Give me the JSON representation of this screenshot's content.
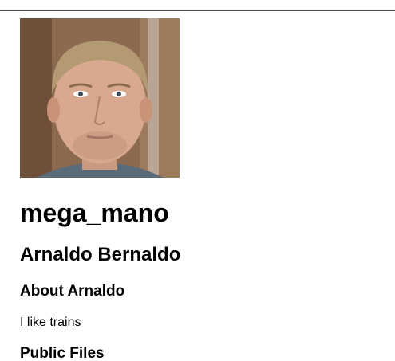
{
  "profile": {
    "username": "mega_mano",
    "full_name": "Arnaldo Bernaldo",
    "about_heading": "About Arnaldo",
    "about_text": "I like trains",
    "files_heading": "Public Files",
    "avatar_alt": "profile-photo"
  },
  "colors": {
    "rule": "#555555",
    "background": "#ffffff",
    "text": "#000000"
  }
}
